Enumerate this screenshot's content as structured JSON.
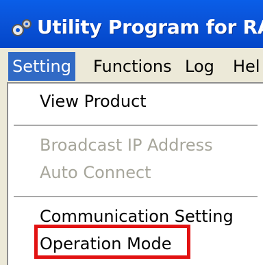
{
  "window": {
    "title": "Utility Program for RA"
  },
  "menubar": {
    "items": [
      {
        "label": "Setting",
        "active": true
      },
      {
        "label": "Functions",
        "active": false
      },
      {
        "label": "Log",
        "active": false
      },
      {
        "label": "Hel",
        "active": false
      }
    ]
  },
  "setting_menu": {
    "items": [
      {
        "label": "View Product",
        "enabled": true
      },
      {
        "label": "Broadcast IP Address",
        "enabled": false
      },
      {
        "label": "Auto Connect",
        "enabled": false
      },
      {
        "label": "Communication Setting",
        "enabled": true
      },
      {
        "label": "Operation Mode",
        "enabled": true,
        "highlighted": true
      }
    ]
  },
  "colors": {
    "titlebar": "#0a53d8",
    "menu_active_bg": "#316ac5",
    "highlight_border": "#e21212",
    "disabled_text": "#a7a69b"
  },
  "icons": {
    "app_icon": "utility-gear-icon"
  }
}
